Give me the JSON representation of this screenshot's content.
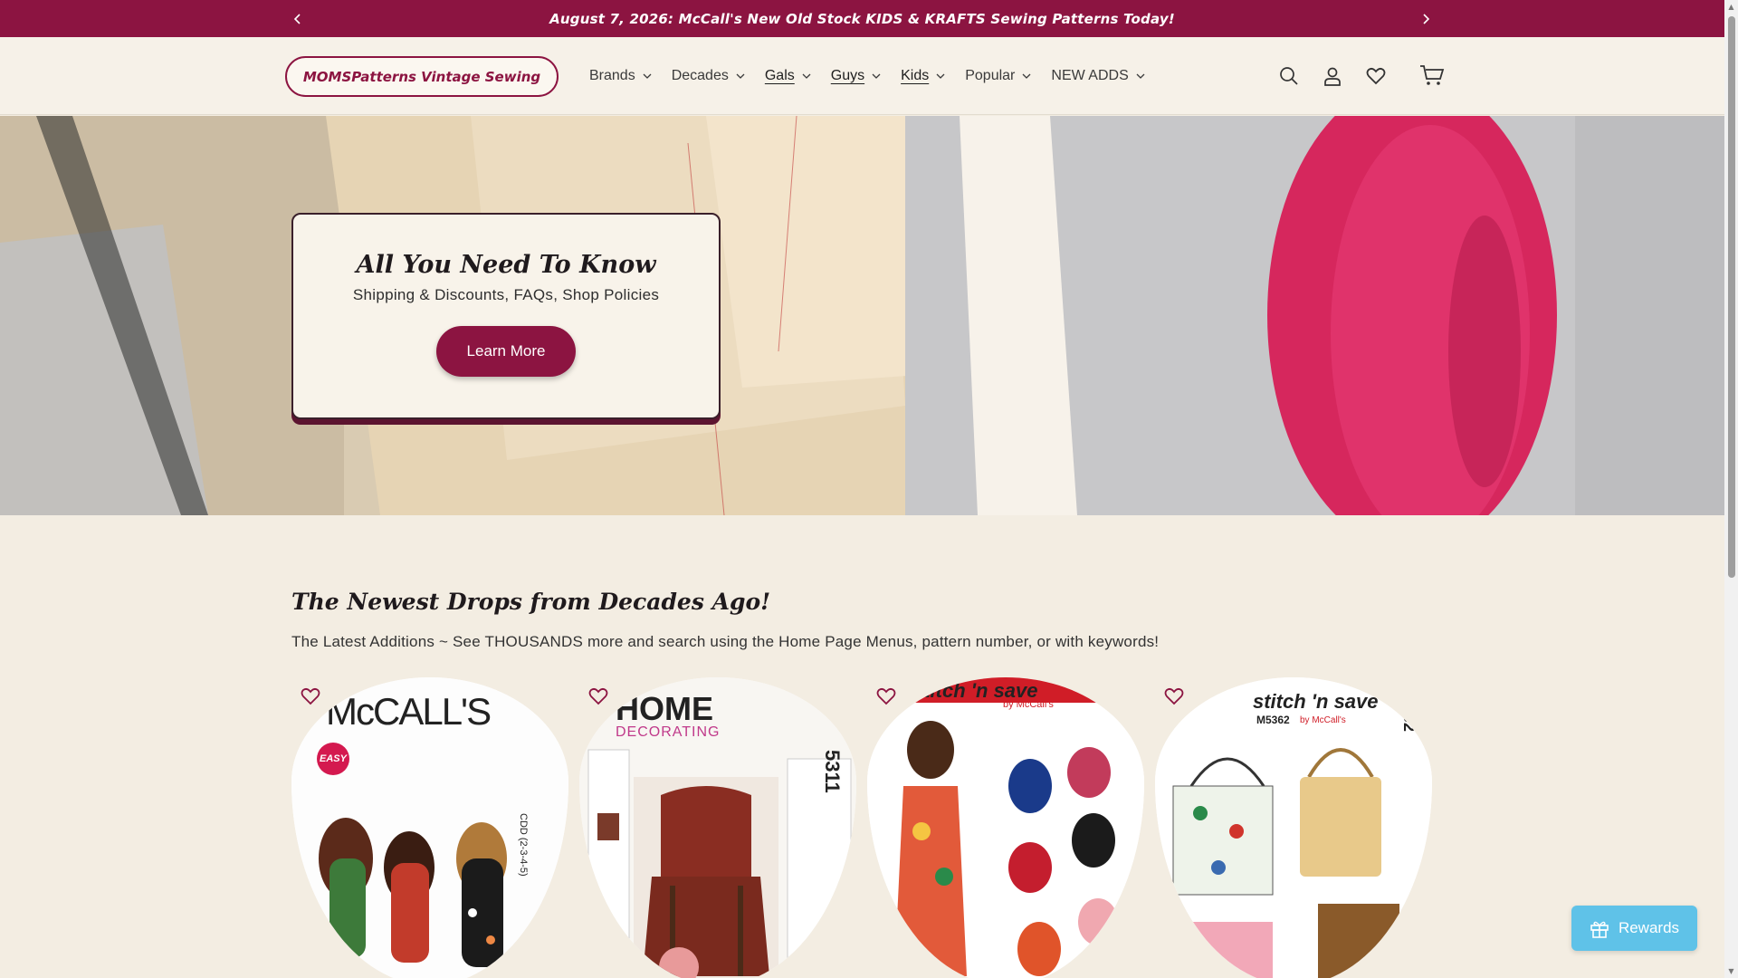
{
  "announcement": {
    "text": "August 7, 2026: McCall's New Old Stock KIDS & KRAFTS Sewing Patterns Today!",
    "prev_icon": "chevron-left-icon",
    "next_icon": "chevron-right-icon"
  },
  "header": {
    "logo": "MOMSPatterns Vintage Sewing",
    "nav": [
      {
        "label": "Brands"
      },
      {
        "label": "Decades"
      },
      {
        "label": "Gals"
      },
      {
        "label": "Guys"
      },
      {
        "label": "Kids"
      },
      {
        "label": "Popular"
      },
      {
        "label": "NEW ADDS"
      }
    ],
    "icons": [
      "search-icon",
      "account-icon",
      "wishlist-heart-icon",
      "cart-icon"
    ]
  },
  "hero": {
    "title": "All You Need To Know",
    "subtitle": "Shipping & Discounts, FAQs, Shop Policies",
    "button": "Learn More"
  },
  "section": {
    "title": "The Newest Drops from Decades Ago!",
    "subtitle": "The Latest Additions ~ See THOUSANDS more and search using the Home Page Menus, pattern number, or with keywords!"
  },
  "products": [
    {
      "brand": "McCALL'S",
      "badge": "EASY",
      "size_text": "CDD (2-3-4-5)"
    },
    {
      "brand": "HOME",
      "brand_sub": "DECORATING",
      "number": "5311"
    },
    {
      "brand": "stitch 'n save",
      "brand_by": "by McCall's"
    },
    {
      "brand": "stitch 'n save",
      "model": "M5362",
      "brand_by": "by McCall's",
      "number": "5362"
    }
  ],
  "rewards": {
    "label": "Rewards"
  },
  "colors": {
    "brand": "#8c1441",
    "background": "#f3ede2",
    "rewards": "#5fc2e8"
  }
}
